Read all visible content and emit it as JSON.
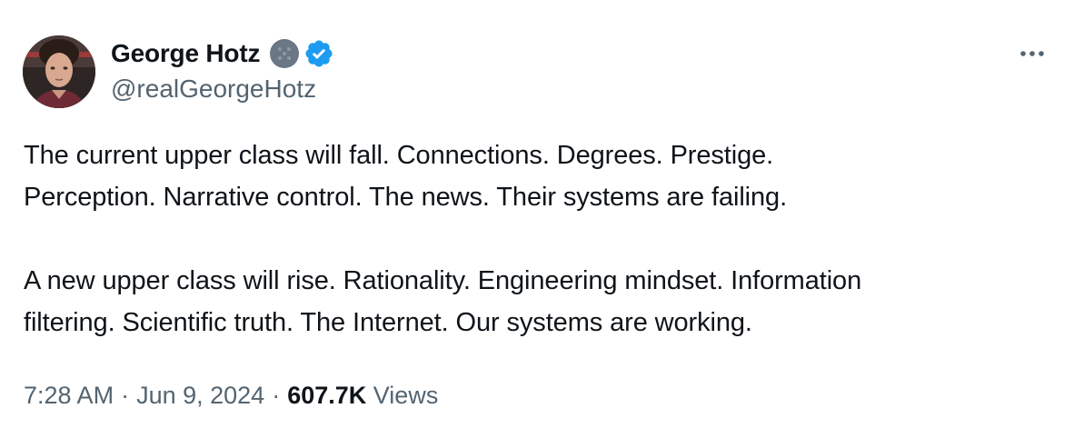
{
  "author": {
    "display_name": "George Hotz",
    "handle": "@realGeorgeHotz",
    "verified_color": "#1d9bf0",
    "affiliate_badge_color": "#6b7785",
    "avatar_icon": "profile-photo"
  },
  "tweet": {
    "paragraphs": [
      "The current upper class will fall. Connections. Degrees. Prestige.\nPerception. Narrative control. The news. Their systems are failing.",
      "A new upper class will rise. Rationality. Engineering mindset. Information\nfiltering. Scientific truth. The Internet. Our systems are working."
    ]
  },
  "meta": {
    "time": "7:28 AM",
    "separator": "·",
    "date": "Jun 9, 2024",
    "views_count": "607.7K",
    "views_label": "Views"
  },
  "menu": {
    "more_icon": "more-horizontal-icon"
  },
  "colors": {
    "text_primary": "#0f1419",
    "text_secondary": "#536471",
    "background": "#ffffff"
  }
}
